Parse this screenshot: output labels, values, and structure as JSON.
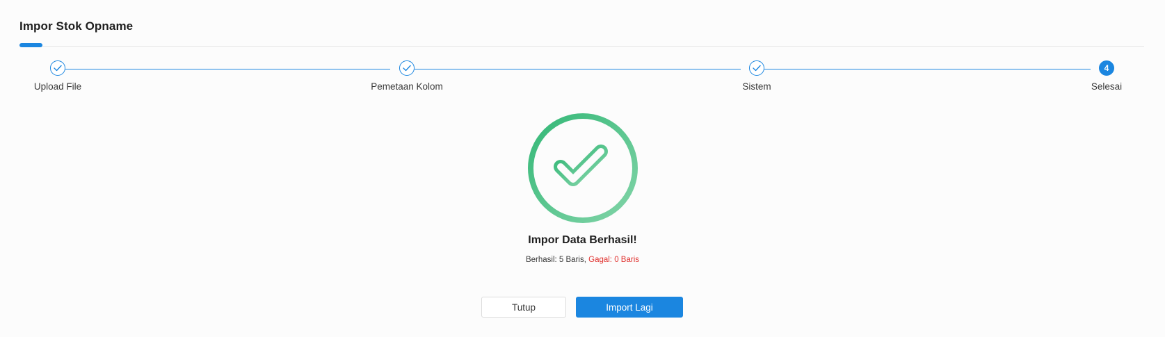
{
  "header": {
    "title": "Impor Stok Opname"
  },
  "stepper": {
    "steps": [
      {
        "label": "Upload File",
        "status": "done",
        "icon": "check-icon"
      },
      {
        "label": "Pemetaan Kolom",
        "status": "done",
        "icon": "check-icon"
      },
      {
        "label": "Sistem",
        "status": "done",
        "icon": "check-icon"
      },
      {
        "label": "Selesai",
        "status": "active",
        "number": "4"
      }
    ]
  },
  "result": {
    "icon": "success-check-icon",
    "title": "Impor Data Berhasil!",
    "success_text": "Berhasil: 5 Baris,",
    "fail_text": "Gagal: 0 Baris"
  },
  "actions": {
    "close_label": "Tutup",
    "import_again_label": "Import Lagi"
  },
  "colors": {
    "primary": "#1b86e0",
    "success": "#3dbd7d",
    "danger": "#e0322f"
  }
}
